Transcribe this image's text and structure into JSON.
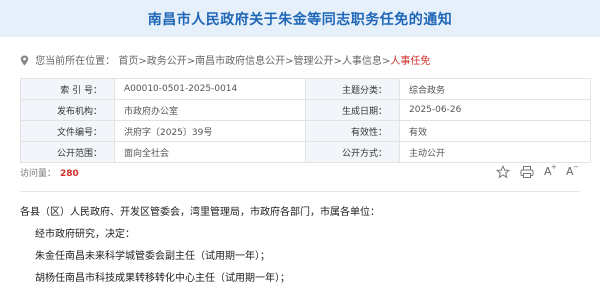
{
  "page": {
    "title": "南昌市人民政府关于朱金等同志职务任免的通知"
  },
  "breadcrumb": {
    "prefix": "您当前所在位置：",
    "items": [
      "首页",
      "政务公开",
      "南昌市政府信息公开",
      "管理公开",
      "人事信息",
      "人事任免"
    ],
    "separator": ">"
  },
  "meta": {
    "rows": [
      [
        {
          "label": "索 引 号：",
          "value": "A00010-0501-2025-0014"
        },
        {
          "label": "主题分类：",
          "value": "综合政务"
        }
      ],
      [
        {
          "label": "发布机构：",
          "value": "市政府办公室"
        },
        {
          "label": "生成日期：",
          "value": "2025-06-26"
        }
      ],
      [
        {
          "label": "文件编号：",
          "value": "洪府字〔2025〕39号"
        },
        {
          "label": "有效性：",
          "value": "有效"
        }
      ],
      [
        {
          "label": "公开范围：",
          "value": "面向全社会"
        },
        {
          "label": "公开方式：",
          "value": "主动公开"
        }
      ]
    ]
  },
  "stats": {
    "views_label": "访问量：",
    "views_count": "280"
  },
  "tools": {
    "font_larger": "A",
    "font_larger_sup": "+",
    "font_smaller": "A",
    "font_smaller_sup": "−"
  },
  "content": {
    "salutation": "各县（区）人民政府、开发区管委会，湾里管理局，市政府各部门，市属各单位：",
    "paragraphs": [
      "经市政府研究，决定：",
      "朱金任南昌未来科学城管委会副主任（试用期一年）；",
      "胡杨任南昌市科技成果转移转化中心主任（试用期一年）；"
    ]
  },
  "colors": {
    "accent": "#1f66b6",
    "header_bg": "#e6f0fb",
    "highlight": "#d0302b"
  }
}
